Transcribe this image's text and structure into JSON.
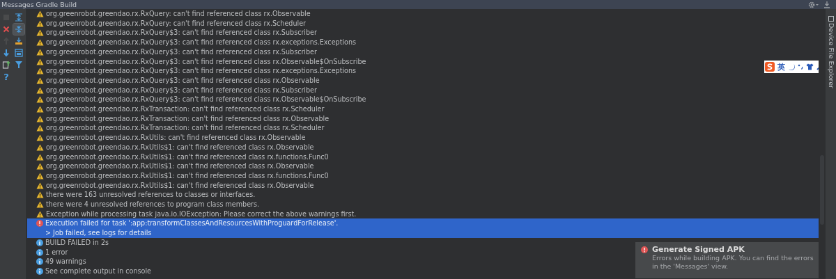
{
  "window": {
    "title": "Messages Gradle Build"
  },
  "toolbar": [
    {
      "kind": "stop",
      "disabled": true,
      "pressed": false
    },
    {
      "kind": "expand",
      "disabled": false,
      "pressed": false
    },
    {
      "kind": "close",
      "disabled": false,
      "pressed": false
    },
    {
      "kind": "collapse",
      "disabled": false,
      "pressed": true
    },
    {
      "kind": "up",
      "disabled": true,
      "pressed": false
    },
    {
      "kind": "export",
      "disabled": false,
      "pressed": false
    },
    {
      "kind": "down",
      "disabled": false,
      "pressed": false
    },
    {
      "kind": "panel",
      "disabled": false,
      "pressed": false
    },
    {
      "kind": "file",
      "disabled": false,
      "pressed": false
    },
    {
      "kind": "filter",
      "disabled": false,
      "pressed": false
    },
    {
      "kind": "help",
      "disabled": false,
      "pressed": false,
      "glyph": "?"
    }
  ],
  "messages": [
    {
      "kind": "warning",
      "selected": false,
      "lines": [
        "org.greenrobot.greendao.rx.RxQuery: can't find referenced class rx.Observable"
      ]
    },
    {
      "kind": "warning",
      "selected": false,
      "lines": [
        "org.greenrobot.greendao.rx.RxQuery: can't find referenced class rx.Scheduler"
      ]
    },
    {
      "kind": "warning",
      "selected": false,
      "lines": [
        "org.greenrobot.greendao.rx.RxQuery$3: can't find referenced class rx.Subscriber"
      ]
    },
    {
      "kind": "warning",
      "selected": false,
      "lines": [
        "org.greenrobot.greendao.rx.RxQuery$3: can't find referenced class rx.exceptions.Exceptions"
      ]
    },
    {
      "kind": "warning",
      "selected": false,
      "lines": [
        "org.greenrobot.greendao.rx.RxQuery$3: can't find referenced class rx.Subscriber"
      ]
    },
    {
      "kind": "warning",
      "selected": false,
      "lines": [
        "org.greenrobot.greendao.rx.RxQuery$3: can't find referenced class rx.Observable$OnSubscribe"
      ]
    },
    {
      "kind": "warning",
      "selected": false,
      "lines": [
        "org.greenrobot.greendao.rx.RxQuery$3: can't find referenced class rx.exceptions.Exceptions"
      ]
    },
    {
      "kind": "warning",
      "selected": false,
      "lines": [
        "org.greenrobot.greendao.rx.RxQuery$3: can't find referenced class rx.Observable"
      ]
    },
    {
      "kind": "warning",
      "selected": false,
      "lines": [
        "org.greenrobot.greendao.rx.RxQuery$3: can't find referenced class rx.Subscriber"
      ]
    },
    {
      "kind": "warning",
      "selected": false,
      "lines": [
        "org.greenrobot.greendao.rx.RxQuery$3: can't find referenced class rx.Observable$OnSubscribe"
      ]
    },
    {
      "kind": "warning",
      "selected": false,
      "lines": [
        "org.greenrobot.greendao.rx.RxTransaction: can't find referenced class rx.Scheduler"
      ]
    },
    {
      "kind": "warning",
      "selected": false,
      "lines": [
        "org.greenrobot.greendao.rx.RxTransaction: can't find referenced class rx.Observable"
      ]
    },
    {
      "kind": "warning",
      "selected": false,
      "lines": [
        "org.greenrobot.greendao.rx.RxTransaction: can't find referenced class rx.Scheduler"
      ]
    },
    {
      "kind": "warning",
      "selected": false,
      "lines": [
        "org.greenrobot.greendao.rx.RxUtils: can't find referenced class rx.Observable"
      ]
    },
    {
      "kind": "warning",
      "selected": false,
      "lines": [
        "org.greenrobot.greendao.rx.RxUtils$1: can't find referenced class rx.Observable"
      ]
    },
    {
      "kind": "warning",
      "selected": false,
      "lines": [
        "org.greenrobot.greendao.rx.RxUtils$1: can't find referenced class rx.functions.Func0"
      ]
    },
    {
      "kind": "warning",
      "selected": false,
      "lines": [
        "org.greenrobot.greendao.rx.RxUtils$1: can't find referenced class rx.Observable"
      ]
    },
    {
      "kind": "warning",
      "selected": false,
      "lines": [
        "org.greenrobot.greendao.rx.RxUtils$1: can't find referenced class rx.functions.Func0"
      ]
    },
    {
      "kind": "warning",
      "selected": false,
      "lines": [
        "org.greenrobot.greendao.rx.RxUtils$1: can't find referenced class rx.Observable"
      ]
    },
    {
      "kind": "warning",
      "selected": false,
      "lines": [
        "there were 163 unresolved references to classes or interfaces."
      ]
    },
    {
      "kind": "warning",
      "selected": false,
      "lines": [
        "there were 4 unresolved references to program class members."
      ]
    },
    {
      "kind": "warning",
      "selected": false,
      "lines": [
        "Exception while processing task java.io.IOException: Please correct the above warnings first."
      ]
    },
    {
      "kind": "error",
      "selected": true,
      "lines": [
        "Execution failed for task ':app:transformClassesAndResourcesWithProguardForRelease'.",
        "> Job failed, see logs for details"
      ]
    },
    {
      "kind": "info",
      "selected": false,
      "lines": [
        "BUILD FAILED in 2s"
      ]
    },
    {
      "kind": "info",
      "selected": false,
      "lines": [
        "1 error"
      ]
    },
    {
      "kind": "info",
      "selected": false,
      "lines": [
        "49 warnings"
      ]
    },
    {
      "kind": "info",
      "selected": false,
      "lines": [
        "See complete output in console"
      ]
    }
  ],
  "ime_bar": {
    "mode": "英"
  },
  "notification": {
    "title": "Generate Signed APK",
    "lines": [
      "Errors while building APK. You can find the errors",
      "in the 'Messages' view."
    ]
  },
  "side_tab": {
    "label": "Device File Explorer"
  }
}
